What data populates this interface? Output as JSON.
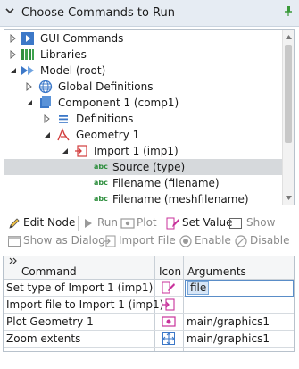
{
  "panel": {
    "title": "Choose Commands to Run"
  },
  "tree": {
    "items": [
      {
        "label": "GUI Commands",
        "icon": "gui-commands-icon"
      },
      {
        "label": "Libraries",
        "icon": "libraries-icon"
      },
      {
        "label": "Model (root)",
        "icon": "model-root-icon"
      },
      {
        "label": "Global Definitions",
        "icon": "globe-icon"
      },
      {
        "label": "Component 1 (comp1)",
        "icon": "component-icon"
      },
      {
        "label": "Definitions",
        "icon": "definitions-icon"
      },
      {
        "label": "Geometry 1",
        "icon": "geometry-icon"
      },
      {
        "label": "Import 1 (imp1)",
        "icon": "import-icon"
      },
      {
        "label": "Source (type)",
        "icon": "abc-icon",
        "selected": true
      },
      {
        "label": "Filename (filename)",
        "icon": "abc-icon"
      },
      {
        "label": "Filename (meshfilename)",
        "icon": "abc-icon"
      }
    ],
    "abc_text": "abc"
  },
  "toolbar": {
    "edit_node": "Edit Node",
    "run": "Run",
    "plot": "Plot",
    "set_value": "Set Value",
    "show": "Show",
    "show_as_dialog": "Show as Dialog",
    "import_file": "Import File",
    "enable": "Enable",
    "disable": "Disable"
  },
  "table": {
    "headers": {
      "command": "Command",
      "icon": "Icon",
      "arguments": "Arguments"
    },
    "rows": [
      {
        "command": "Set type of Import 1 (imp1)",
        "icon": "set-value-icon",
        "arguments": "file",
        "editing": true
      },
      {
        "command": "Import file to Import 1 (imp1)",
        "icon": "import-file-icon",
        "arguments": ""
      },
      {
        "command": "Plot Geometry 1",
        "icon": "plot-icon",
        "arguments": "main/graphics1"
      },
      {
        "command": "Zoom extents",
        "icon": "zoom-extents-icon",
        "arguments": "main/graphics1"
      }
    ]
  },
  "colors": {
    "accent": "#3c78c8",
    "title_bg": "#e6ecf3",
    "selected_row": "#d6d9dc",
    "geometry_red": "#d23c3c",
    "pencil_pink": "#c8329b"
  }
}
